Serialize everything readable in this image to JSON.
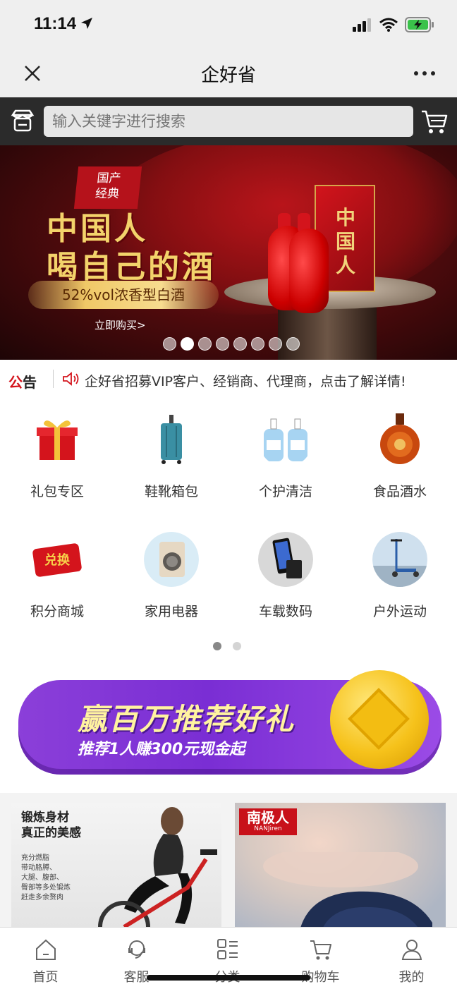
{
  "status_bar": {
    "time": "11:14"
  },
  "nav": {
    "title": "企好省"
  },
  "search": {
    "placeholder": "输入关键字进行搜索"
  },
  "banner": {
    "tag_line1": "国产",
    "tag_line2": "经典",
    "headline1": "中国人",
    "headline2": "喝自己的酒",
    "subtitle": "52%vol浓香型白酒",
    "cta": "立即购买>",
    "box_text": "中国人",
    "slide_count": 8,
    "active_slide": 2
  },
  "notice": {
    "label_red": "公",
    "label_dark": "告",
    "text": "企好省招募VIP客户、经销商、代理商，点击了解详情!"
  },
  "categories": [
    {
      "label": "礼包专区",
      "icon": "gift-box-icon"
    },
    {
      "label": "鞋靴箱包",
      "icon": "suitcase-icon"
    },
    {
      "label": "个护清洁",
      "icon": "lotion-bottles-icon"
    },
    {
      "label": "食品酒水",
      "icon": "cognac-bottle-icon"
    },
    {
      "label": "积分商城",
      "icon": "points-exchange-icon"
    },
    {
      "label": "家用电器",
      "icon": "washing-machine-icon"
    },
    {
      "label": "车载数码",
      "icon": "smartphone-icon"
    },
    {
      "label": "户外运动",
      "icon": "scooter-icon"
    }
  ],
  "category_pages": {
    "count": 2,
    "active": 1
  },
  "promo": {
    "title": "赢百万推荐好礼",
    "subtitle": "推荐1人赚300元现金起"
  },
  "products": [
    {
      "title_line1": "锻炼身材",
      "title_line2": "真正的美感",
      "details": [
        "充分燃脂",
        "带动胳膊、",
        "大腿、腹部、",
        "臀部等多处锻炼",
        "赶走多余赘肉"
      ]
    },
    {
      "brand": "南极人",
      "brand_sub": "NANJiren"
    }
  ],
  "tabs": [
    {
      "label": "首页",
      "icon": "home-icon"
    },
    {
      "label": "客服",
      "icon": "customer-service-icon"
    },
    {
      "label": "分类",
      "icon": "category-grid-icon"
    },
    {
      "label": "购物车",
      "icon": "shopping-cart-icon"
    },
    {
      "label": "我的",
      "icon": "user-icon"
    }
  ],
  "colors": {
    "brand_red": "#d4141c",
    "search_bar_bg": "#2b2b2b",
    "promo_purple": "#7a2ed4"
  }
}
